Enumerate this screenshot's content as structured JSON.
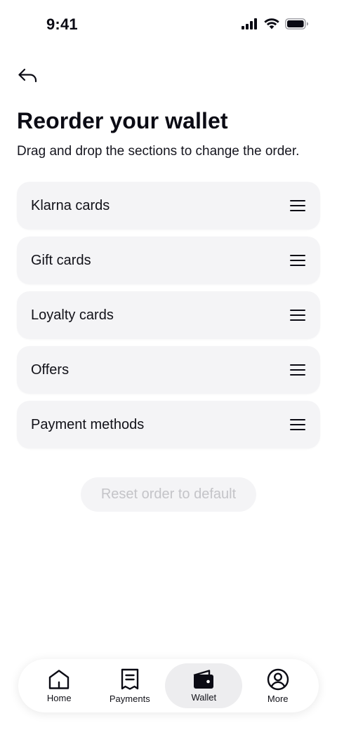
{
  "status_bar": {
    "time": "9:41"
  },
  "header": {
    "title": "Reorder your wallet",
    "subtitle": "Drag and drop the sections to change the order."
  },
  "sections": [
    {
      "label": "Klarna cards"
    },
    {
      "label": "Gift cards"
    },
    {
      "label": "Loyalty cards"
    },
    {
      "label": "Offers"
    },
    {
      "label": "Payment methods"
    }
  ],
  "reset_button": {
    "label": "Reset order to default"
  },
  "tab_bar": {
    "active": "Wallet",
    "tabs": [
      {
        "label": "Home",
        "icon": "home-icon"
      },
      {
        "label": "Payments",
        "icon": "receipt-icon"
      },
      {
        "label": "Wallet",
        "icon": "wallet-icon"
      },
      {
        "label": "More",
        "icon": "profile-icon"
      }
    ]
  }
}
